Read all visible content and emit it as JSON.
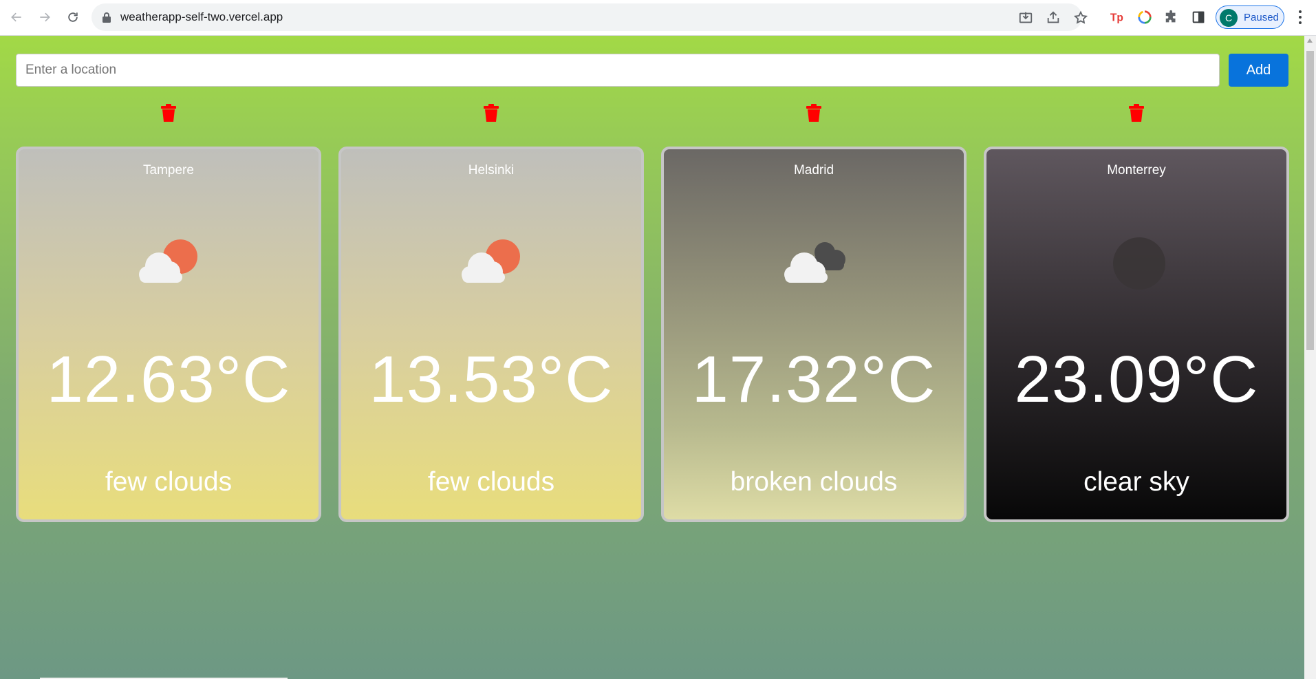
{
  "browser": {
    "url": "weatherapp-self-two.vercel.app",
    "profile_initial": "C",
    "profile_status": "Paused",
    "icons": [
      "back-arrow-icon",
      "forward-arrow-icon",
      "reload-icon",
      "lock-icon",
      "install-icon",
      "share-icon",
      "star-icon",
      "extension-tp-icon",
      "extension-color-icon",
      "puzzle-icon",
      "side-panel-icon",
      "kebab-menu-icon"
    ]
  },
  "search": {
    "placeholder": "Enter a location",
    "value": "",
    "add_label": "Add"
  },
  "colors": {
    "add_button": "#0873dc",
    "trash": "#ff0000",
    "background_top": "#a2d946",
    "background_bottom": "#6d9884"
  },
  "cards": [
    {
      "city": "Tampere",
      "temp": "12.63°C",
      "description": "few clouds",
      "icon": "few-clouds-icon"
    },
    {
      "city": "Helsinki",
      "temp": "13.53°C",
      "description": "few clouds",
      "icon": "few-clouds-icon"
    },
    {
      "city": "Madrid",
      "temp": "17.32°C",
      "description": "broken clouds",
      "icon": "broken-clouds-icon"
    },
    {
      "city": "Monterrey",
      "temp": "23.09°C",
      "description": "clear sky",
      "icon": "clear-night-icon"
    }
  ]
}
